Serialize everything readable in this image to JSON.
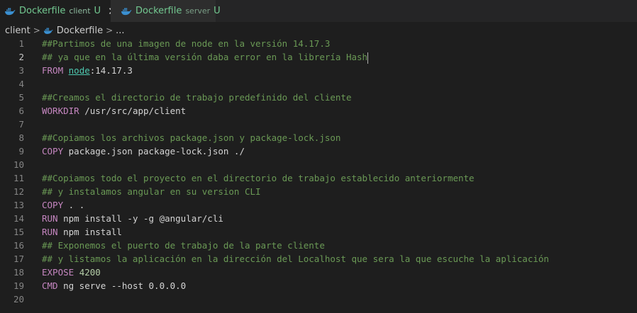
{
  "tabs": [
    {
      "name": "Dockerfile",
      "dir": "client",
      "status": "U",
      "close": "✕"
    },
    {
      "name": "Dockerfile",
      "dir": "server",
      "status": "U"
    }
  ],
  "breadcrumb": {
    "folder": "client",
    "file": "Dockerfile",
    "ellipsis": "..."
  },
  "lines": [
    {
      "n": "1",
      "t": [
        {
          "c": "comment",
          "v": "##Partimos de una imagen de node en la versión 14.17.3"
        }
      ]
    },
    {
      "n": "2",
      "t": [
        {
          "c": "comment",
          "v": "## ya que en la última versión daba error en la librería Hash"
        }
      ],
      "cursor": true
    },
    {
      "n": "3",
      "t": [
        {
          "c": "kw",
          "v": "FROM "
        },
        {
          "c": "img",
          "v": "node"
        },
        {
          "c": "txt",
          "v": ":14.17.3"
        }
      ]
    },
    {
      "n": "4",
      "t": []
    },
    {
      "n": "5",
      "t": [
        {
          "c": "comment",
          "v": "##Creamos el directorio de trabajo predefinido del cliente"
        }
      ]
    },
    {
      "n": "6",
      "t": [
        {
          "c": "kw",
          "v": "WORKDIR "
        },
        {
          "c": "txt",
          "v": "/usr/src/app/client"
        }
      ]
    },
    {
      "n": "7",
      "t": []
    },
    {
      "n": "8",
      "t": [
        {
          "c": "comment",
          "v": "##Copiamos los archivos package.json y package-lock.json"
        }
      ]
    },
    {
      "n": "9",
      "t": [
        {
          "c": "kw",
          "v": "COPY "
        },
        {
          "c": "txt",
          "v": "package.json package-lock.json ./"
        }
      ]
    },
    {
      "n": "10",
      "t": []
    },
    {
      "n": "11",
      "t": [
        {
          "c": "comment",
          "v": "##Copiamos todo el proyecto en el directorio de trabajo establecido anteriormente"
        }
      ]
    },
    {
      "n": "12",
      "t": [
        {
          "c": "comment",
          "v": "## y instalamos angular en su version CLI"
        }
      ]
    },
    {
      "n": "13",
      "t": [
        {
          "c": "kw",
          "v": "COPY "
        },
        {
          "c": "txt",
          "v": ". ."
        }
      ]
    },
    {
      "n": "14",
      "t": [
        {
          "c": "kw",
          "v": "RUN "
        },
        {
          "c": "txt",
          "v": "npm install -y -g @angular/cli"
        }
      ]
    },
    {
      "n": "15",
      "t": [
        {
          "c": "kw",
          "v": "RUN "
        },
        {
          "c": "txt",
          "v": "npm install"
        }
      ]
    },
    {
      "n": "16",
      "t": [
        {
          "c": "comment",
          "v": "## Exponemos el puerto de trabajo de la parte cliente"
        }
      ]
    },
    {
      "n": "17",
      "t": [
        {
          "c": "comment",
          "v": "## y listamos la aplicación en la dirección del Localhost que sera la que escuche la aplicación"
        }
      ]
    },
    {
      "n": "18",
      "t": [
        {
          "c": "kw",
          "v": "EXPOSE "
        },
        {
          "c": "num",
          "v": "4200"
        }
      ]
    },
    {
      "n": "19",
      "t": [
        {
          "c": "kw",
          "v": "CMD "
        },
        {
          "c": "txt",
          "v": "ng serve --host 0.0.0.0"
        }
      ]
    },
    {
      "n": "20",
      "t": []
    }
  ],
  "current_line": "2",
  "colors": {
    "comment": "#6a9955",
    "keyword": "#c586c0",
    "text": "#d4d4d4",
    "image": "#4ec9b0",
    "number": "#b5cea8",
    "untracked": "#73c991"
  }
}
